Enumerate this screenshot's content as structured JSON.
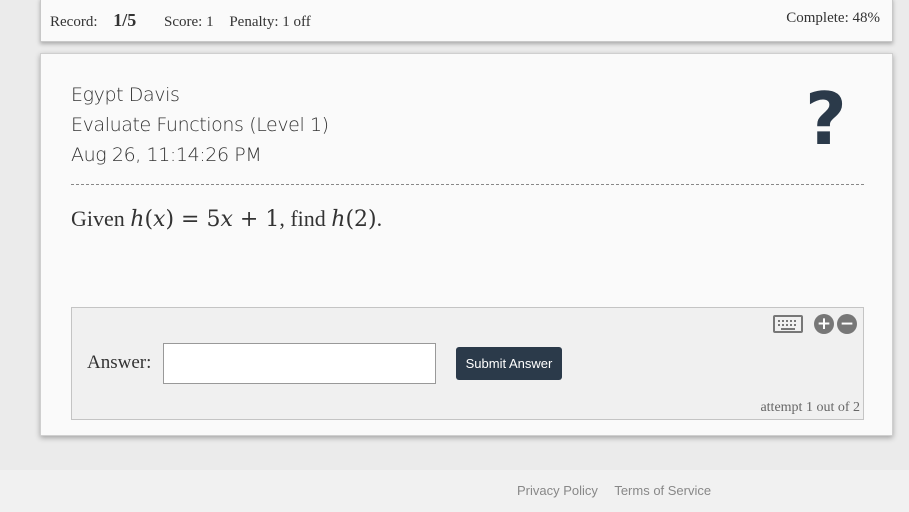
{
  "status": {
    "record_label": "Record:",
    "record_value": "1/5",
    "score": "Score: 1",
    "penalty": "Penalty: 1 off",
    "complete": "Complete: 48%"
  },
  "meta": {
    "student_name": "Egypt Davis",
    "assignment": "Evaluate Functions (Level 1)",
    "timestamp": "Aug 26, 11:14:26 PM"
  },
  "help": {
    "symbol": "?"
  },
  "question": {
    "prefix": "Given ",
    "fn": "h",
    "var": "x",
    "rhs_coef": "5",
    "rhs_const": "1",
    "mid": ", find ",
    "arg": "2",
    "suffix": "."
  },
  "answer": {
    "label": "Answer:",
    "value": "",
    "placeholder": "",
    "submit_label": "Submit Answer",
    "attempt_text": "attempt 1 out of 2",
    "zoom_in_symbol": "+",
    "zoom_out_symbol": "−"
  },
  "footer": {
    "privacy": "Privacy Policy",
    "terms": "Terms of Service"
  },
  "colors": {
    "accent": "#2b3a4a",
    "background": "#ebebeb",
    "card": "#fafafa"
  },
  "icons": [
    "help-icon",
    "keyboard-icon",
    "zoom-in-icon",
    "zoom-out-icon"
  ]
}
